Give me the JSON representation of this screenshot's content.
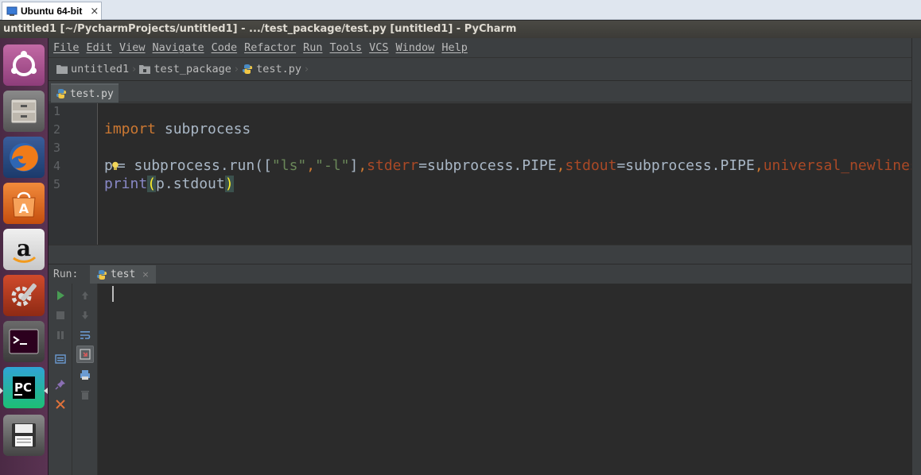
{
  "vm": {
    "tab_label": "Ubuntu 64-bit",
    "close_glyph": "×"
  },
  "window": {
    "title": "untitled1 [~/PycharmProjects/untitled1] - .../test_package/test.py [untitled1] - PyCharm"
  },
  "launcher": {
    "items": [
      "ubuntu-dash-icon",
      "files-icon",
      "firefox-icon",
      "software-center-icon",
      "amazon-icon",
      "system-settings-icon",
      "terminal-icon",
      "pycharm-icon",
      "save-disk-icon"
    ]
  },
  "menu": {
    "items": [
      "File",
      "Edit",
      "View",
      "Navigate",
      "Code",
      "Refactor",
      "Run",
      "Tools",
      "VCS",
      "Window",
      "Help"
    ]
  },
  "breadcrumbs": [
    {
      "label": "untitled1",
      "icon": "folder-icon"
    },
    {
      "label": "test_package",
      "icon": "package-folder-icon"
    },
    {
      "label": "test.py",
      "icon": "python-file-icon"
    }
  ],
  "editor_tab": {
    "label": "test.py",
    "icon": "python-file-icon"
  },
  "editor": {
    "line_numbers": [
      "1",
      "2",
      "3",
      "4",
      "5"
    ],
    "line2": {
      "kw": "import",
      "rest": " subprocess"
    },
    "line4": {
      "var": "p",
      "eq": "= subprocess.run([",
      "s1": "\"ls\"",
      "c1": ",",
      "s2": "\"-l\"",
      "close": "]",
      "c2": ",",
      "p1": "stderr",
      "v1": "=subprocess.PIPE",
      "c3": ",",
      "p2": "stdout",
      "v2": "=subprocess.PIPE",
      "c4": ",",
      "p3": "universal_newlines"
    },
    "line5": {
      "fn": "print",
      "open": "(",
      "mid": "p.stdout",
      "close": ")"
    }
  },
  "run_panel": {
    "label": "Run:",
    "tab_label": "test",
    "tab_close": "×"
  },
  "colors": {
    "keyword": "#cc7832",
    "string": "#6a8759",
    "param": "#aa4926",
    "builtin": "#8888c6",
    "default_text": "#a9b7c6"
  }
}
